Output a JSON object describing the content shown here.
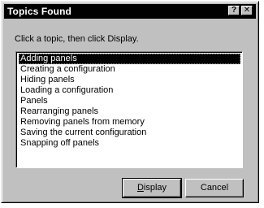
{
  "window": {
    "title": "Topics Found",
    "help_glyph": "?",
    "close_glyph": "✕"
  },
  "instruction": "Click a topic, then click Display.",
  "topics": [
    "Adding panels",
    "Creating a configuration",
    "Hiding panels",
    "Loading a configuration",
    "Panels",
    "Rearranging panels",
    "Removing panels from memory",
    "Saving the current configuration",
    "Snapping off panels"
  ],
  "selected_index": 0,
  "buttons": {
    "display_mnemonic": "D",
    "display_rest": "isplay",
    "cancel": "Cancel"
  }
}
